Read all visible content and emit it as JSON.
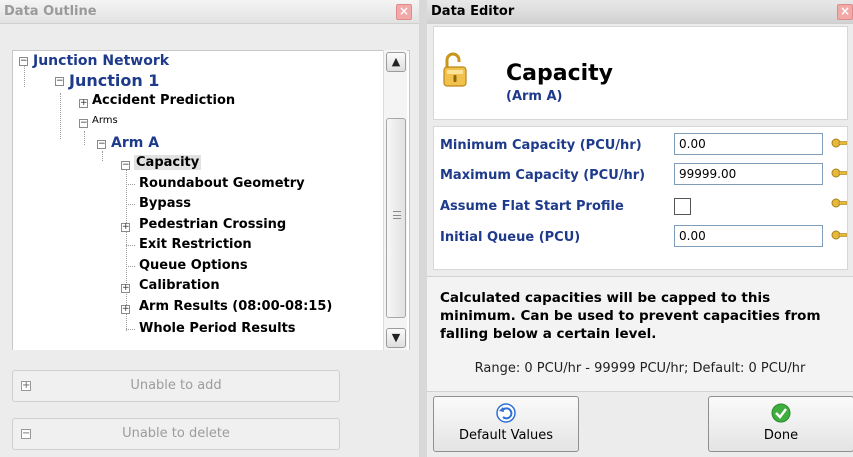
{
  "outline": {
    "title": "Data Outline",
    "close_glyph": "×",
    "tree": [
      {
        "label": "Junction Network",
        "expander": "−"
      },
      {
        "label": "Junction 1",
        "expander": "−"
      },
      {
        "label": "Accident Prediction",
        "expander": "+"
      },
      {
        "label": "Arms",
        "expander": "−"
      },
      {
        "label": "Arm A",
        "expander": "−"
      },
      {
        "label": "Capacity",
        "expander": "−"
      },
      {
        "label": "Roundabout Geometry",
        "expander": ""
      },
      {
        "label": "Bypass",
        "expander": ""
      },
      {
        "label": "Pedestrian Crossing",
        "expander": "+"
      },
      {
        "label": "Exit Restriction",
        "expander": ""
      },
      {
        "label": "Queue Options",
        "expander": ""
      },
      {
        "label": "Calibration",
        "expander": "+"
      },
      {
        "label": "Arm Results (08:00-08:15)",
        "expander": "+"
      },
      {
        "label": "Whole Period Results",
        "expander": ""
      }
    ],
    "add_button": {
      "label": "Unable to add",
      "glyph": "+"
    },
    "delete_button": {
      "label": "Unable to delete",
      "glyph": "−"
    }
  },
  "editor": {
    "title": "Data Editor",
    "close_glyph": "×",
    "header_title": "Capacity",
    "header_subtitle": "(Arm A)",
    "header_icon": "padlock-open-icon",
    "properties": [
      {
        "label": "Minimum Capacity (PCU/hr)",
        "value": "0.00",
        "type": "text"
      },
      {
        "label": "Maximum Capacity (PCU/hr)",
        "value": "99999.00",
        "type": "text"
      },
      {
        "label": "Assume Flat Start Profile",
        "value": "",
        "type": "checkbox",
        "checked": false
      },
      {
        "label": "Initial Queue (PCU)",
        "value": "0.00",
        "type": "text"
      }
    ],
    "row_icon": "key-icon",
    "description": "Calculated capacities will be capped to this minimum. Can be used to prevent capacities from falling below a certain level.",
    "range_text": "Range: 0 PCU/hr - 99999 PCU/hr; Default: 0 PCU/hr",
    "default_button": {
      "label": "Default Values",
      "icon": "undo-icon"
    },
    "done_button": {
      "label": "Done",
      "icon": "check-icon"
    }
  },
  "colors": {
    "tree_heading": "#1e3a8a",
    "property_label": "#1e3a8a",
    "close_button": "#f3a8a8",
    "done_green": "#3fae3f",
    "undo_blue": "#2f6fd8"
  }
}
